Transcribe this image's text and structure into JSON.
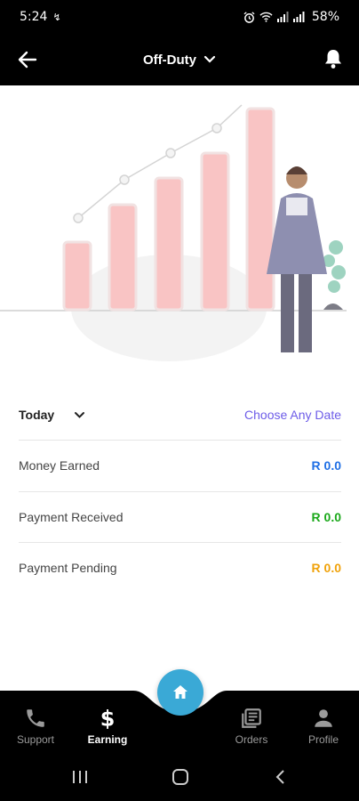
{
  "status_bar": {
    "time": "5:24",
    "battery": "58%"
  },
  "app_bar": {
    "duty_status": "Off-Duty"
  },
  "filter": {
    "period": "Today",
    "choose_date": "Choose Any Date"
  },
  "earnings": [
    {
      "label": "Money Earned",
      "value": "R 0.0",
      "color": "#1f6fe5"
    },
    {
      "label": "Payment Received",
      "value": "R 0.0",
      "color": "#1aa81a"
    },
    {
      "label": "Payment Pending",
      "value": "R 0.0",
      "color": "#f0a20a"
    }
  ],
  "bottom_nav": {
    "support": "Support",
    "earning": "Earning",
    "orders": "Orders",
    "profile": "Profile"
  },
  "colors": {
    "accent": "#6d5ce8",
    "home_button": "#3aa9d6",
    "bar_fill": "#f9c4c4"
  },
  "icons": [
    "back-arrow-icon",
    "chevron-down-icon",
    "bell-icon",
    "phone-icon",
    "dollar-icon",
    "home-icon",
    "orders-icon",
    "person-icon"
  ]
}
